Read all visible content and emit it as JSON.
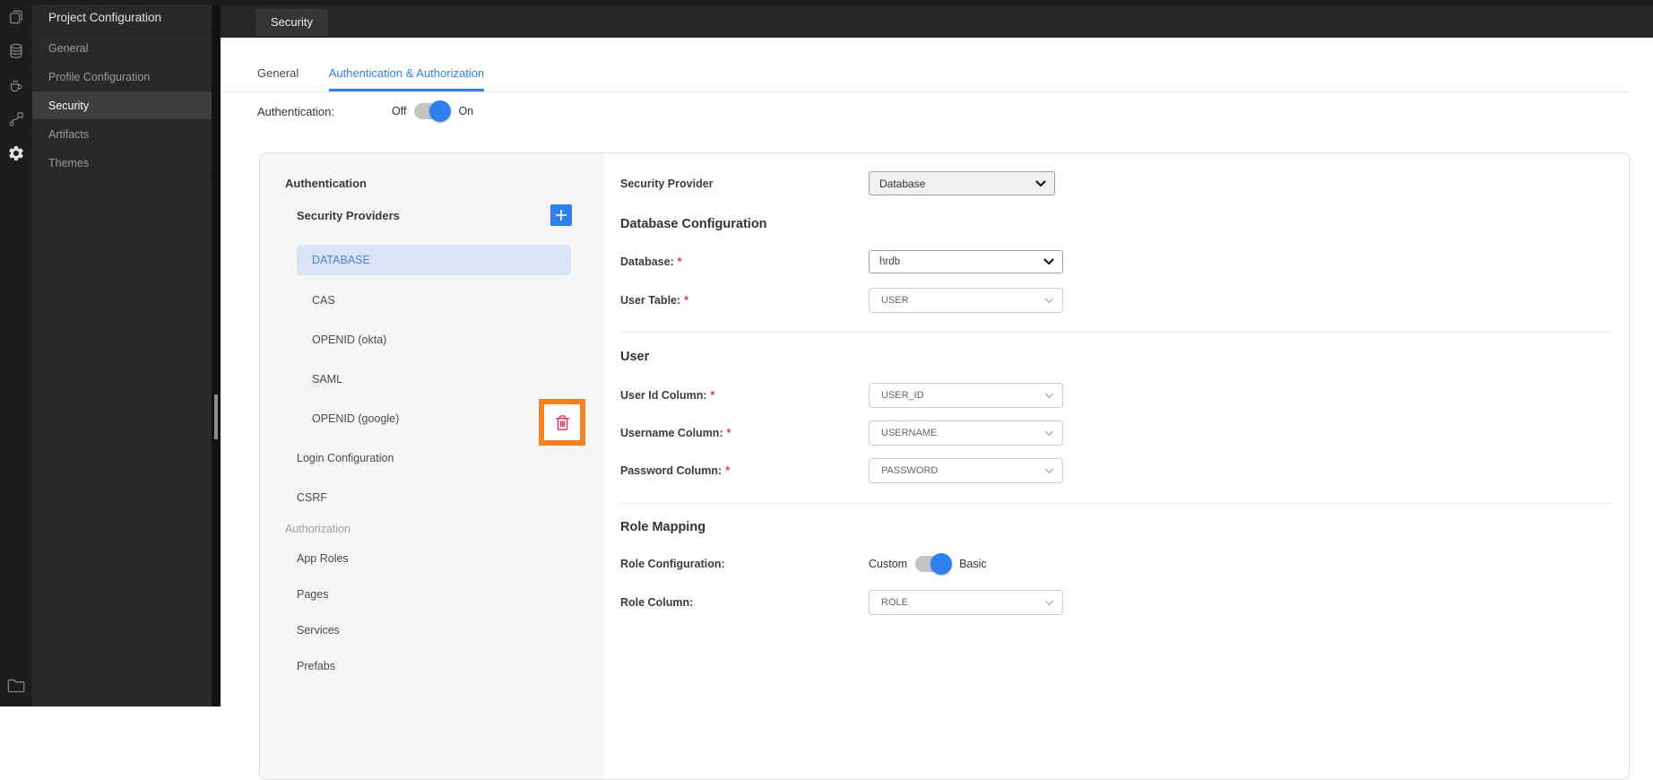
{
  "header": {
    "tab": "Security"
  },
  "rail": {
    "icons": [
      "pages-icon",
      "database-icon",
      "java-service-icon",
      "api-icon",
      "settings-icon"
    ],
    "bottom_icon": "folder-icon"
  },
  "sidebar": {
    "title": "Project Configuration",
    "items": [
      {
        "label": "General"
      },
      {
        "label": "Profile Configuration"
      },
      {
        "label": "Security"
      },
      {
        "label": "Artifacts"
      },
      {
        "label": "Themes"
      }
    ],
    "active": "Security"
  },
  "tabs": {
    "items": [
      {
        "label": "General"
      },
      {
        "label": "Authentication & Authorization"
      }
    ],
    "active": "Authentication & Authorization"
  },
  "auth": {
    "label": "Authentication:",
    "off": "Off",
    "on": "On",
    "value": "On"
  },
  "nav": {
    "section_authentication": "Authentication",
    "security_providers_label": "Security Providers",
    "providers": [
      "DATABASE",
      "CAS",
      "OPENID (okta)",
      "SAML",
      "OPENID (google)"
    ],
    "selected_provider": "DATABASE",
    "login_configuration": "Login Configuration",
    "csrf": "CSRF",
    "section_authorization": "Authorization",
    "authorization_items": [
      "App Roles",
      "Pages",
      "Services",
      "Prefabs"
    ]
  },
  "form": {
    "security_provider": {
      "label": "Security Provider",
      "value": "Database"
    },
    "database_configuration": {
      "heading": "Database Configuration",
      "database": {
        "label": "Database:",
        "required": "*",
        "value": "hrdb"
      },
      "user_table": {
        "label": "User Table:",
        "required": "*",
        "value": "USER"
      }
    },
    "user": {
      "heading": "User",
      "user_id_column": {
        "label": "User Id Column:",
        "required": "*",
        "value": "USER_ID"
      },
      "username_column": {
        "label": "Username Column:",
        "required": "*",
        "value": "USERNAME"
      },
      "password_column": {
        "label": "Password Column:",
        "required": "*",
        "value": "PASSWORD"
      }
    },
    "role_mapping": {
      "heading": "Role Mapping",
      "role_configuration": {
        "label": "Role Configuration:",
        "left": "Custom",
        "right": "Basic",
        "value": "Basic"
      },
      "role_column": {
        "label": "Role Column:",
        "value": "ROLE"
      }
    }
  },
  "colors": {
    "accent": "#2f80ed",
    "selection_bg": "#dbe4f6",
    "annotation_orange": "#f6821f",
    "delete_red": "#e8335e",
    "required_red": "#e53935"
  }
}
